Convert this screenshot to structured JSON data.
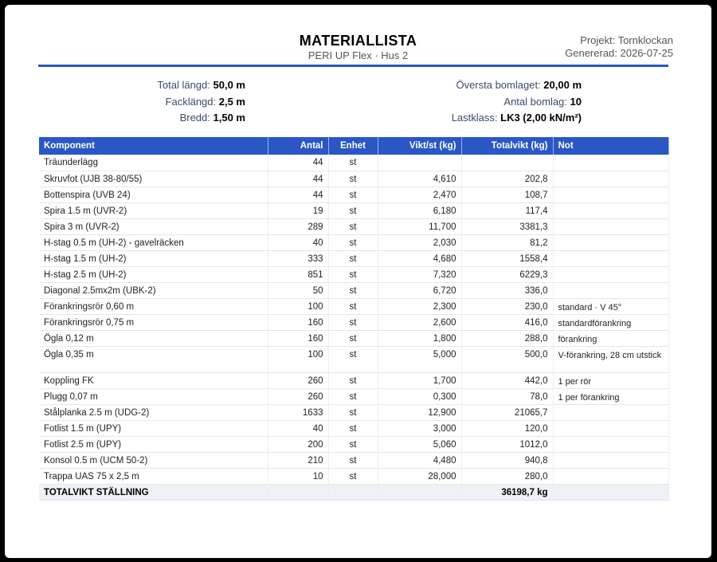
{
  "doc": {
    "title": "MATERIALLISTA",
    "subtitle": "PERI UP Flex · Hus 2",
    "project": "Projekt: Tornklockan",
    "generated": "Genererad: 2026-07-25"
  },
  "params": {
    "left": [
      {
        "label": "Total längd:",
        "value": "50,0 m"
      },
      {
        "label": "Facklängd:",
        "value": "2,5 m"
      },
      {
        "label": "Bredd:",
        "value": "1,50 m"
      }
    ],
    "right": [
      {
        "label": "Översta bomlaget:",
        "value": "20,00 m"
      },
      {
        "label": "Antal bomlag:",
        "value": "10"
      },
      {
        "label": "Lastklass:",
        "value": "LK3 (2,00 kN/m²)"
      }
    ]
  },
  "table": {
    "headers": [
      "Komponent",
      "Antal",
      "Enhet",
      "Vikt/st (kg)",
      "Totalvikt (kg)",
      "Not"
    ],
    "rows": [
      [
        "Träunderlägg",
        "44",
        "st",
        "",
        "",
        ""
      ],
      [
        "Skruvfot (UJB 38-80/55)",
        "44",
        "st",
        "4,610",
        "202,8",
        ""
      ],
      [
        "Bottenspira (UVB 24)",
        "44",
        "st",
        "2,470",
        "108,7",
        ""
      ],
      [
        "Spira 1.5 m (UVR-2)",
        "19",
        "st",
        "6,180",
        "117,4",
        ""
      ],
      [
        "Spira 3 m (UVR-2)",
        "289",
        "st",
        "11,700",
        "3381,3",
        ""
      ],
      [
        "H-stag 0.5 m (UH-2) - gavelräcken",
        "40",
        "st",
        "2,030",
        "81,2",
        ""
      ],
      [
        "H-stag 1.5 m (UH-2)",
        "333",
        "st",
        "4,680",
        "1558,4",
        ""
      ],
      [
        "H-stag 2.5 m (UH-2)",
        "851",
        "st",
        "7,320",
        "6229,3",
        ""
      ],
      [
        "Diagonal 2.5mx2m (UBK-2)",
        "50",
        "st",
        "6,720",
        "336,0",
        ""
      ],
      [
        "Förankringsrör 0,60 m",
        "100",
        "st",
        "2,300",
        "230,0",
        "standard · V 45°"
      ],
      [
        "Förankringsrör 0,75 m",
        "160",
        "st",
        "2,600",
        "416,0",
        "standardförankring"
      ],
      [
        "Ögla 0,12 m",
        "160",
        "st",
        "1,800",
        "288,0",
        "förankring"
      ],
      [
        "Ögla 0,35 m",
        "100",
        "st",
        "5,000",
        "500,0",
        "V-förankring, 28 cm utstick"
      ],
      [
        "Koppling FK",
        "260",
        "st",
        "1,700",
        "442,0",
        "1 per rör"
      ],
      [
        "Plugg 0,07 m",
        "260",
        "st",
        "0,300",
        "78,0",
        "1 per förankring"
      ],
      [
        "Stålplanka 2.5 m (UDG-2)",
        "1633",
        "st",
        "12,900",
        "21065,7",
        ""
      ],
      [
        "Fotlist 1.5 m (UPY)",
        "40",
        "st",
        "3,000",
        "120,0",
        ""
      ],
      [
        "Fotlist 2.5 m (UPY)",
        "200",
        "st",
        "5,060",
        "1012,0",
        ""
      ],
      [
        "Konsol 0.5 m (UCM 50-2)",
        "210",
        "st",
        "4,480",
        "940,8",
        ""
      ],
      [
        "Trappa UAS 75 x 2,5 m",
        "10",
        "st",
        "28,000",
        "280,0",
        ""
      ]
    ],
    "total": {
      "label": "TOTALVIKT STÄLLNING",
      "value": "36198,7 kg"
    }
  }
}
